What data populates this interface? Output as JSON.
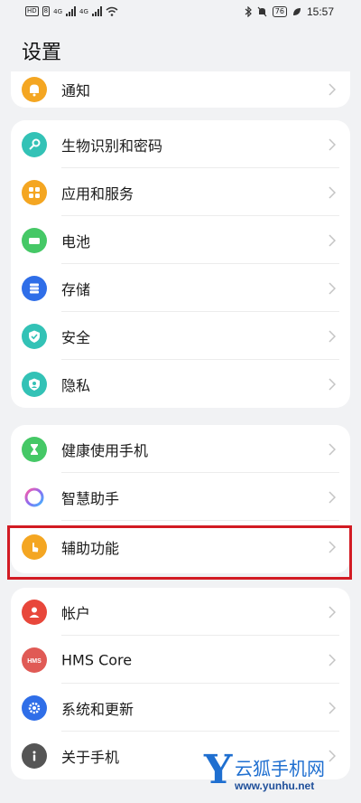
{
  "status_bar": {
    "left_chips": [
      "HD",
      "8"
    ],
    "signal_labels": [
      "4G",
      "4G"
    ],
    "battery": "76",
    "time": "15:57"
  },
  "page": {
    "title": "设置"
  },
  "groups": [
    {
      "items": [
        {
          "label": "通知",
          "icon": "bell-icon",
          "color": "#f4a622"
        }
      ]
    },
    {
      "items": [
        {
          "label": "生物识别和密码",
          "icon": "key-icon",
          "color": "#33c2b6"
        },
        {
          "label": "应用和服务",
          "icon": "apps-icon",
          "color": "#f4a622"
        },
        {
          "label": "电池",
          "icon": "battery-icon",
          "color": "#45c866"
        },
        {
          "label": "存储",
          "icon": "storage-icon",
          "color": "#2f6ee8"
        },
        {
          "label": "安全",
          "icon": "shield-check-icon",
          "color": "#33c2b6"
        },
        {
          "label": "隐私",
          "icon": "privacy-icon",
          "color": "#33c2b6"
        }
      ]
    },
    {
      "items": [
        {
          "label": "健康使用手机",
          "icon": "hourglass-icon",
          "color": "#45c866"
        },
        {
          "label": "智慧助手",
          "icon": "assistant-ring-icon",
          "color": "#a070ee"
        },
        {
          "label": "辅助功能",
          "icon": "hand-tap-icon",
          "color": "#f4a622"
        }
      ]
    },
    {
      "items": [
        {
          "label": "帐户",
          "icon": "account-icon",
          "color": "#e8473b"
        },
        {
          "label": "HMS Core",
          "icon": "hms-icon",
          "color": "#e05a55"
        },
        {
          "label": "系统和更新",
          "icon": "gear-icon",
          "color": "#2f6ee8"
        },
        {
          "label": "关于手机",
          "icon": "info-icon",
          "color": "#555555"
        }
      ]
    }
  ],
  "watermark": {
    "letter": "Y",
    "name": "云狐手机网",
    "url": "www.yunhu.net"
  }
}
